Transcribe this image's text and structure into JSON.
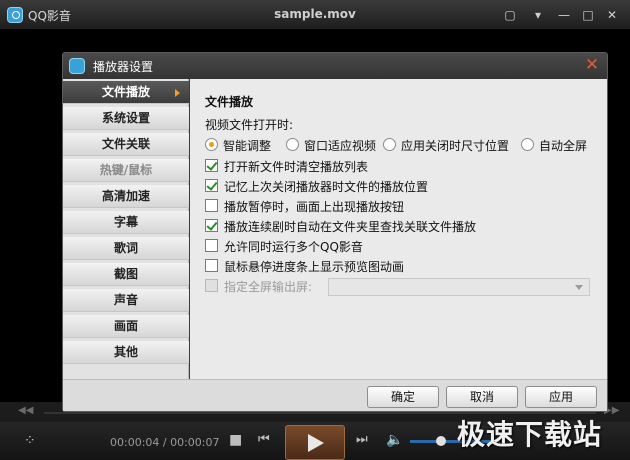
{
  "window": {
    "app_name": "QQ影音",
    "file_title": "sample.mov"
  },
  "player": {
    "time": "00:00:04 / 00:00:07"
  },
  "watermark": "极速下载站",
  "dialog": {
    "title": "播放器设置",
    "sidebar": [
      {
        "label": "文件播放",
        "active": true
      },
      {
        "label": "系统设置"
      },
      {
        "label": "文件关联"
      },
      {
        "label": "热键/鼠标",
        "disabled": true
      },
      {
        "label": "高清加速"
      },
      {
        "label": "字幕"
      },
      {
        "label": "歌词"
      },
      {
        "label": "截图"
      },
      {
        "label": "声音"
      },
      {
        "label": "画面"
      },
      {
        "label": "其他"
      }
    ],
    "section_title": "文件播放",
    "open_label": "视频文件打开时:",
    "radios": [
      {
        "label": "智能调整",
        "checked": true
      },
      {
        "label": "窗口适应视频"
      },
      {
        "label": "应用关闭时尺寸位置"
      },
      {
        "label": "自动全屏"
      }
    ],
    "checkboxes": [
      {
        "label": "打开新文件时清空播放列表",
        "checked": true
      },
      {
        "label": "记忆上次关闭播放器时文件的播放位置",
        "checked": true
      },
      {
        "label": "播放暂停时，画面上出现播放按钮",
        "checked": false
      },
      {
        "label": "播放连续剧时自动在文件夹里查找关联文件播放",
        "checked": true
      },
      {
        "label": "允许同时运行多个QQ影音",
        "checked": false
      },
      {
        "label": "鼠标悬停进度条上显示预览图动画",
        "checked": false
      }
    ],
    "fullscreen_output_label": "指定全屏输出屏:",
    "buttons": {
      "ok": "确定",
      "cancel": "取消",
      "apply": "应用"
    }
  }
}
